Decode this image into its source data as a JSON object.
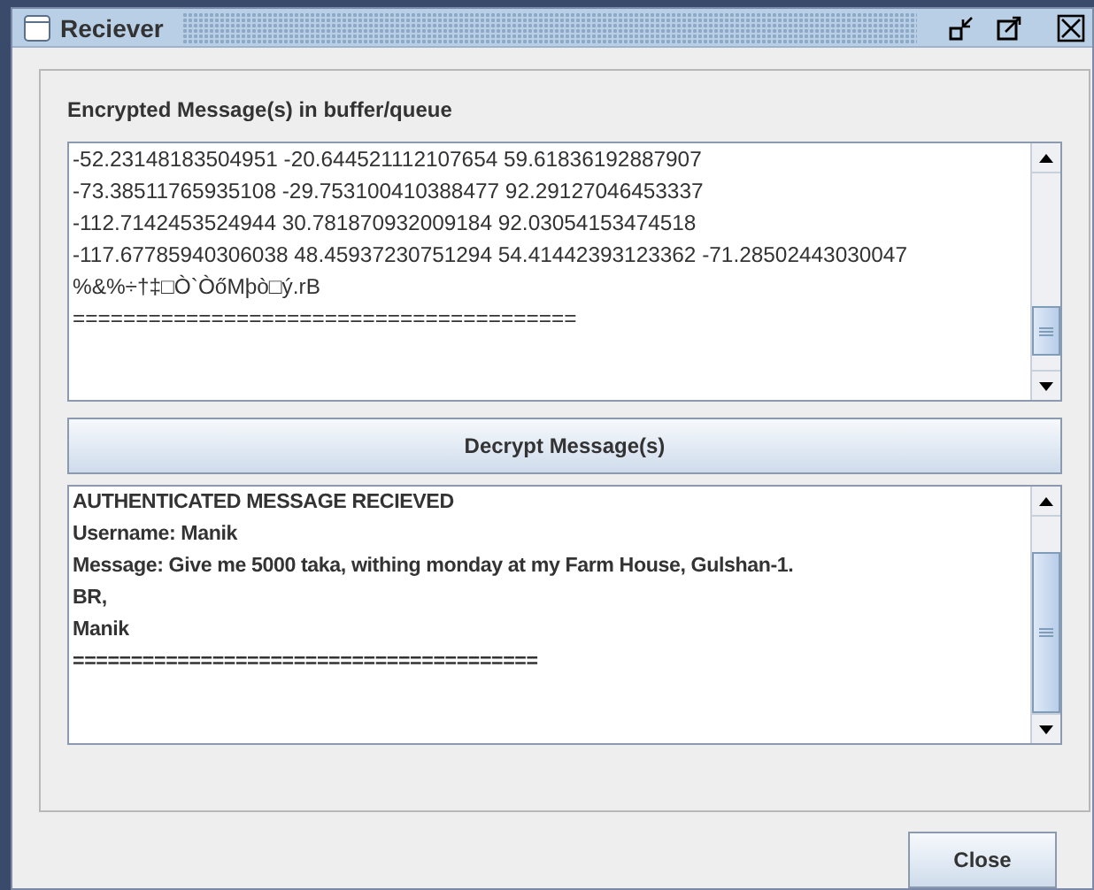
{
  "window": {
    "title": "Reciever"
  },
  "encrypted": {
    "label": "Encrypted Message(s) in buffer/queue",
    "lines": [
      "-52.23148183504951 -20.644521112107654 59.61836192887907",
      "-73.38511765935108 -29.753100410388477 92.29127046453337",
      "-112.7142453524944 30.781870932009184 92.03054153474518",
      "-117.67785940306038 48.45937230751294 54.41442393123362 -71.28502443030047",
      "%&%÷†‡□Ò`ÒőMþò□ý.rB",
      "========================================"
    ]
  },
  "decrypt_button": "Decrypt Message(s)",
  "decrypted": {
    "lines": [
      "AUTHENTICATED MESSAGE RECIEVED",
      "Username: Manik",
      "Message: Give me 5000 taka, withing monday at my Farm House, Gulshan-1.",
      "BR,",
      "Manik",
      "========================================"
    ]
  },
  "close_button": "Close"
}
